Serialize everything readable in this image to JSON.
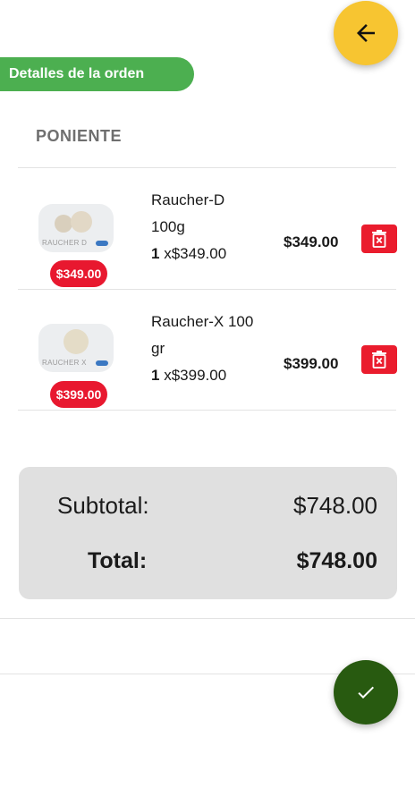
{
  "header": {
    "back_icon": "arrow-left-icon",
    "back_color": "#f7c531",
    "banner_label": "Detalles de la orden",
    "banner_color": "#4caf50"
  },
  "store": {
    "name": "PONIENTE"
  },
  "items": [
    {
      "name_line1": "Raucher-D",
      "name_line2": "100g",
      "quantity": "1",
      "unit_price": "x$349.00",
      "badge_price": "$349.00",
      "line_total": "$349.00",
      "thumb_text": "RAUCHER D",
      "delete_icon": "trash-icon"
    },
    {
      "name_line1": "Raucher-X 100",
      "name_line2": "gr",
      "quantity": "1",
      "unit_price": "x$399.00",
      "badge_price": "$399.00",
      "line_total": "$399.00",
      "thumb_text": "RAUCHER X",
      "delete_icon": "trash-icon"
    }
  ],
  "summary": {
    "subtotal_label": "Subtotal:",
    "subtotal_value": "$748.00",
    "total_label": "Total:",
    "total_value": "$748.00"
  },
  "confirm": {
    "icon": "check-icon",
    "color": "#285a10"
  },
  "colors": {
    "badge": "#e8182f",
    "delete": "#ea1c2d",
    "card": "#e0e0e0"
  }
}
